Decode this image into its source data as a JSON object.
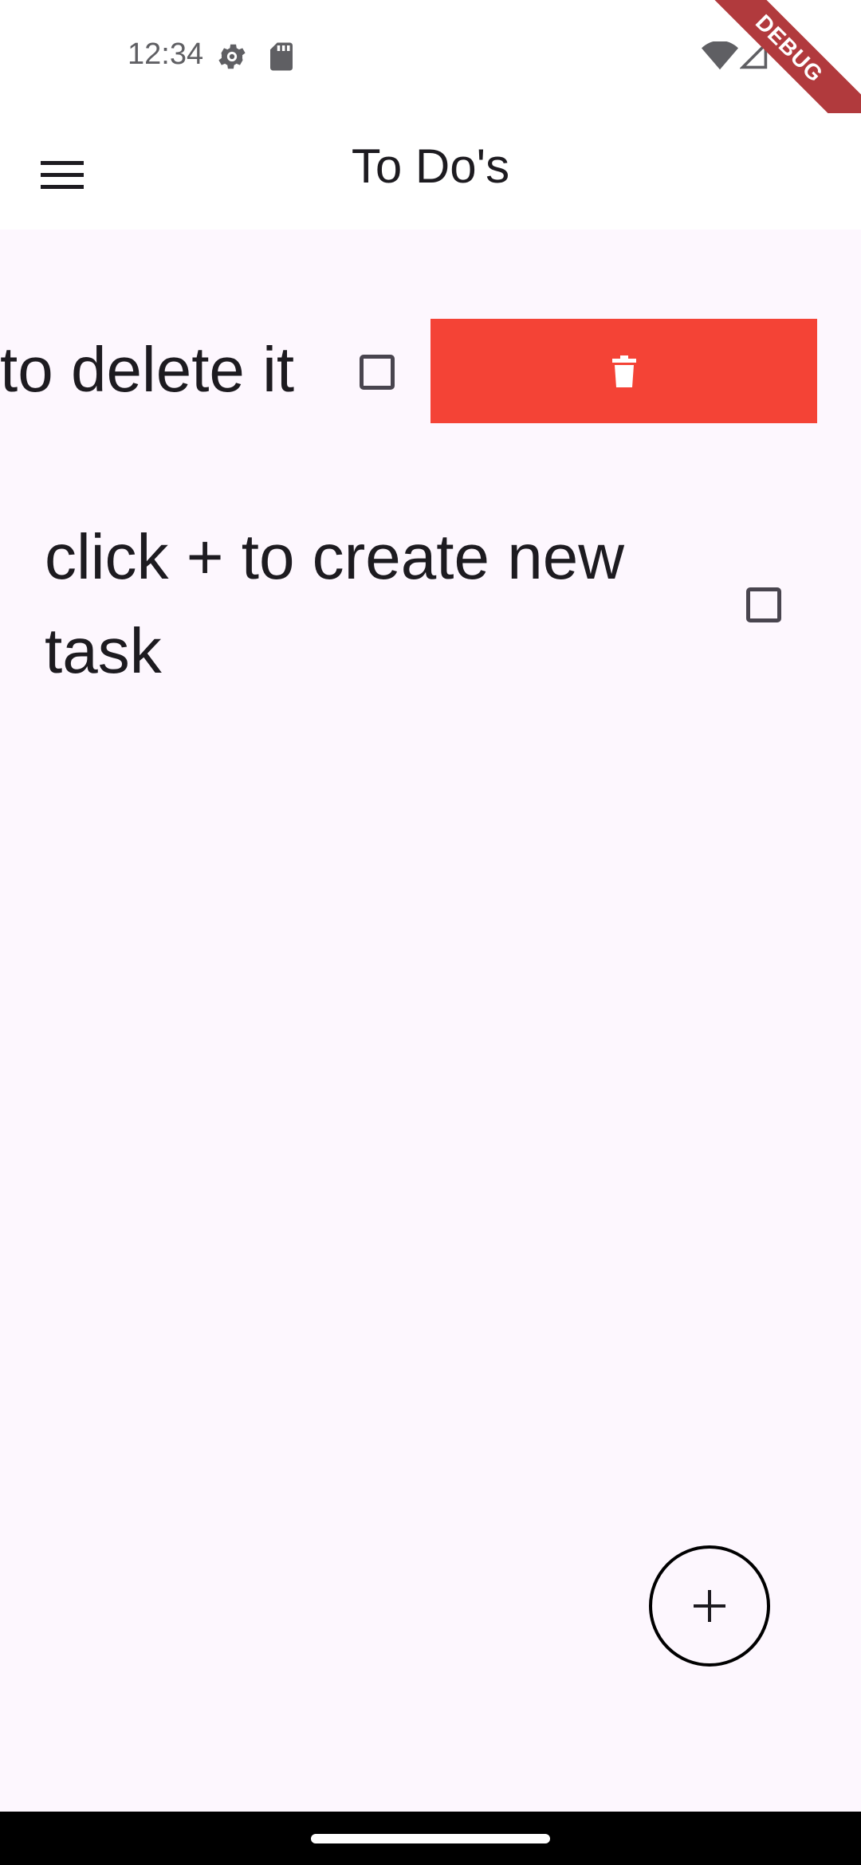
{
  "status_bar": {
    "time": "12:34",
    "icons": [
      "settings-gear-icon",
      "sd-card-icon",
      "wifi-icon",
      "cell-signal-icon"
    ]
  },
  "debug_banner": {
    "label": "DEBUG"
  },
  "app_bar": {
    "title": "To Do's",
    "menu_icon": "hamburger-menu-icon"
  },
  "tasks": [
    {
      "text": "to delete it",
      "checked": false,
      "swiped": true,
      "delete_icon": "trash-icon"
    },
    {
      "text": "click + to create new task",
      "checked": false,
      "swiped": false
    }
  ],
  "fab": {
    "icon": "plus-icon"
  },
  "colors": {
    "background": "#fdf7fe",
    "app_bar": "#ffffff",
    "delete_red": "#f44336",
    "debug_ribbon": "#b13a3d",
    "text": "#1d1b20"
  }
}
